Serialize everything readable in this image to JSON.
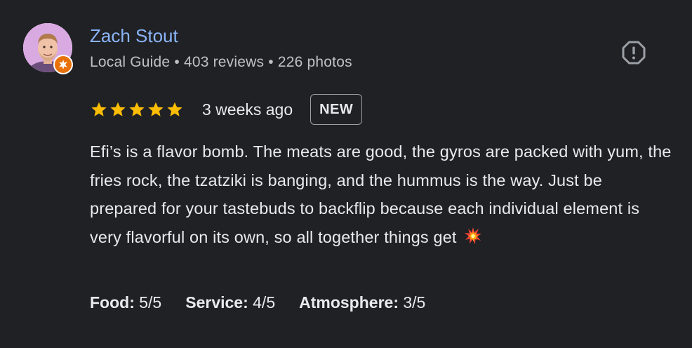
{
  "reviewer": {
    "name": "Zach Stout",
    "level": "Local Guide",
    "separator1": "•",
    "reviews_count": "403 reviews",
    "separator2": "•",
    "photos_count": "226 photos"
  },
  "rating": {
    "stars": 5,
    "max_stars": 5,
    "time_ago": "3 weeks ago",
    "badge": "NEW"
  },
  "review": {
    "text": "Efi’s is a flavor bomb. The meats are good, the gyros are packed with yum, the fries rock, the tzatziki is banging, and the hummus is the way. Just be prepared for your tastebuds to backflip because each individual element is very flavorful on its own, so all together things get",
    "trailing_emoji": "collision-emoji"
  },
  "subratings": [
    {
      "label": "Food:",
      "value": "5/5"
    },
    {
      "label": "Service:",
      "value": "4/5"
    },
    {
      "label": "Atmosphere:",
      "value": "3/5"
    }
  ],
  "icons": {
    "report": "report-flag-icon",
    "guide_badge": "local-guide-star-icon",
    "star": "star-icon"
  },
  "colors": {
    "background": "#202124",
    "name": "#8ab4f8",
    "star": "#fbbc04",
    "guide_badge": "#e8710a"
  }
}
